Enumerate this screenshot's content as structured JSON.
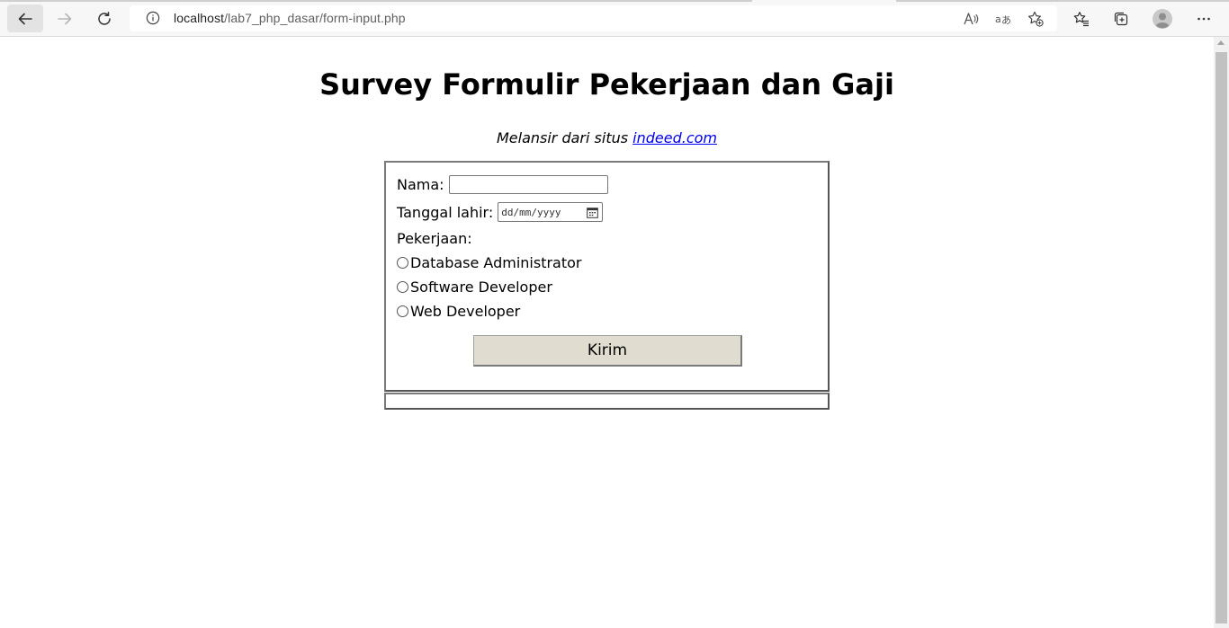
{
  "browser": {
    "url_host": "localhost",
    "url_path": "/lab7_php_dasar/form-input.php",
    "icons": [
      "back-icon",
      "forward-icon",
      "refresh-icon",
      "info-icon",
      "read-aloud-icon",
      "translate-icon",
      "add-favorite-icon",
      "favorites-icon",
      "collections-icon",
      "profile-icon",
      "more-icon"
    ]
  },
  "page": {
    "title": "Survey Formulir Pekerjaan dan Gaji",
    "source_prefix": "Melansir dari situs",
    "source_link": "indeed.com"
  },
  "form": {
    "name_label": "Nama:",
    "name_value": "",
    "dob_label": "Tanggal lahir:",
    "dob_placeholder": "dd/mm/yyyy",
    "job_label": "Pekerjaan:",
    "job_options": [
      "Database Administrator",
      "Software Developer",
      "Web Developer"
    ],
    "submit_label": "Kirim"
  },
  "colors": {
    "link": "#0000ee",
    "button_bg": "#e0dccf",
    "toolbar_bg": "#f7f7f7"
  }
}
